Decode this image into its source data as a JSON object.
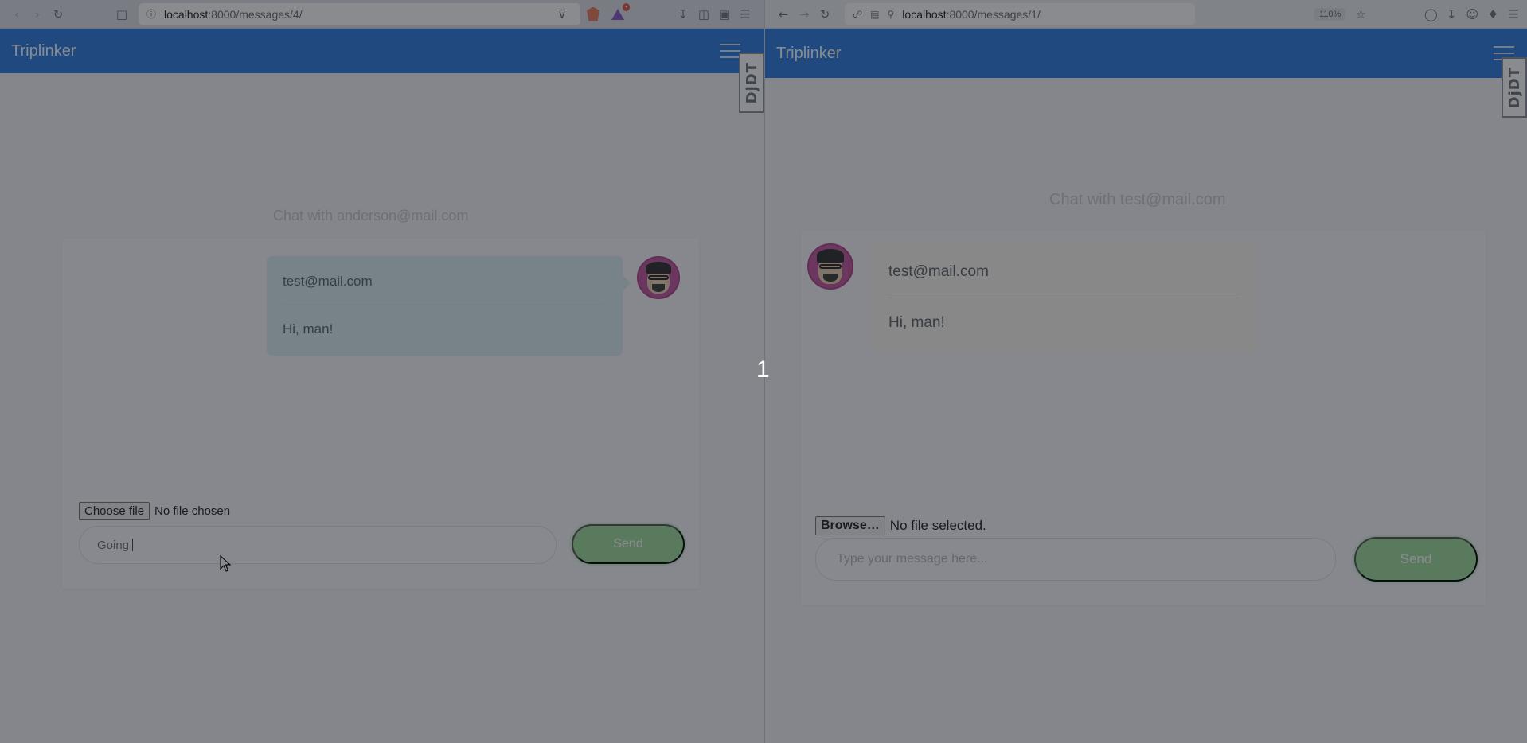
{
  "left_window": {
    "browser": {
      "url_host": "localhost",
      "url_path": ":8000/messages/4/"
    },
    "app": {
      "brand": "Triplinker",
      "debug_toolbar_label": "DjDT",
      "chat_title": "Chat with anderson@mail.com",
      "message": {
        "sender": "test@mail.com",
        "text": "Hi, man!"
      },
      "form": {
        "file_button": "Choose file",
        "file_status": "No file chosen",
        "message_value": "Going",
        "send_label": "Send"
      }
    }
  },
  "right_window": {
    "browser": {
      "url_host": "localhost",
      "url_path": ":8000/messages/1/",
      "zoom": "110%"
    },
    "app": {
      "brand": "Triplinker",
      "debug_toolbar_label": "DjDT",
      "chat_title": "Chat with test@mail.com",
      "message": {
        "sender": "test@mail.com",
        "text": "Hi, man!"
      },
      "form": {
        "file_button": "Browse…",
        "file_status": "No file selected.",
        "message_placeholder": "Type your message here...",
        "send_label": "Send"
      }
    }
  },
  "step_label": "1",
  "colors": {
    "navbar": "#2d7be0",
    "left_bubble": "#dbeff2",
    "right_bubble": "#fbf8ee",
    "send_button": "#9fdc9a",
    "avatar_ring": "#c3579c",
    "overlay": "rgba(20, 24, 32, 0.5)"
  },
  "icons": {
    "left_chrome": [
      "chevron-left-icon",
      "chevron-right-icon",
      "reload-icon",
      "bookmark-icon",
      "site-info-icon",
      "share-icon",
      "brave-shield-icon",
      "brave-rewards-icon",
      "download-icon",
      "sidebar-icon",
      "wallet-icon",
      "menu-icon"
    ],
    "right_chrome": [
      "back-arrow-icon",
      "forward-arrow-icon",
      "reload-icon",
      "shield-icon",
      "page-icon",
      "key-icon",
      "star-icon",
      "pocket-icon",
      "download-icon",
      "account-icon",
      "extensions-icon",
      "menu-icon"
    ]
  }
}
